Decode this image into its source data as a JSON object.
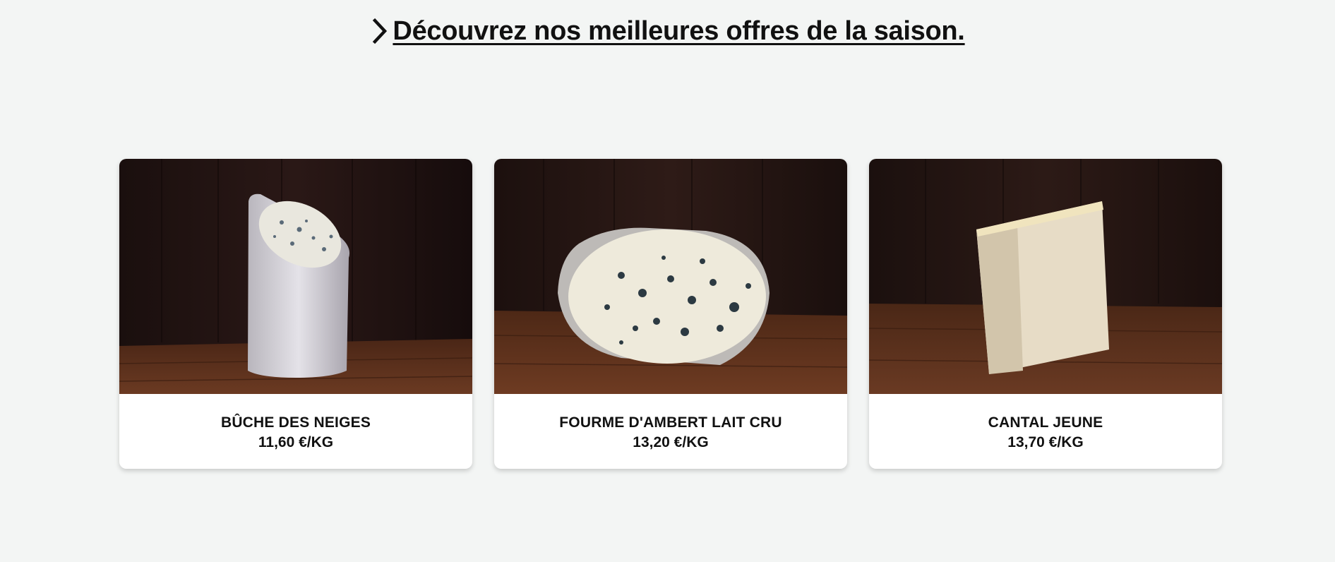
{
  "promo": {
    "headline": "Découvrez nos meilleures offres de la saison.",
    "icon": "chevron-right-icon"
  },
  "products": [
    {
      "name": "BÛCHE DES NEIGES",
      "price": "11,60 €/KG",
      "image": "buche-cheese-photo"
    },
    {
      "name": "FOURME D'AMBERT LAIT CRU",
      "price": "13,20 €/KG",
      "image": "fourme-cheese-photo"
    },
    {
      "name": "CANTAL JEUNE",
      "price": "13,70 €/KG",
      "image": "cantal-cheese-photo"
    }
  ],
  "colors": {
    "background": "#f3f5f4",
    "text": "#111111",
    "wood_dark": "#1f1211",
    "table_wood": "#5a2f1c"
  }
}
